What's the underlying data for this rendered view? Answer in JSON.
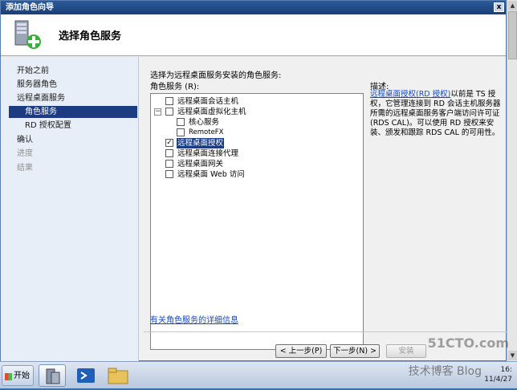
{
  "window": {
    "title": "添加角色向导",
    "close_glyph": "x"
  },
  "header": {
    "title": "选择角色服务"
  },
  "nav": {
    "items": [
      {
        "label": "开始之前",
        "state": "normal"
      },
      {
        "label": "服务器角色",
        "state": "normal"
      },
      {
        "label": "远程桌面服务",
        "state": "normal"
      },
      {
        "label": "角色服务",
        "state": "active"
      },
      {
        "label": "RD 授权配置",
        "state": "sub"
      },
      {
        "label": "确认",
        "state": "normal"
      },
      {
        "label": "进度",
        "state": "disabled"
      },
      {
        "label": "结果",
        "state": "disabled"
      }
    ]
  },
  "content": {
    "prompt": "选择为远程桌面服务安装的角色服务:",
    "role_services_label": "角色服务 (R):",
    "tree": [
      {
        "label": "远程桌面会话主机",
        "checked": false,
        "level": 0
      },
      {
        "label": "远程桌面虚拟化主机",
        "checked": false,
        "level": 0,
        "expander": "−"
      },
      {
        "label": "核心服务",
        "checked": false,
        "level": 1
      },
      {
        "label": "RemoteFX",
        "checked": false,
        "level": 1
      },
      {
        "label": "远程桌面授权",
        "checked": true,
        "level": 0,
        "selected": true
      },
      {
        "label": "远程桌面连接代理",
        "checked": false,
        "level": 0
      },
      {
        "label": "远程桌面网关",
        "checked": false,
        "level": 0
      },
      {
        "label": "远程桌面 Web 访问",
        "checked": false,
        "level": 0
      }
    ],
    "description_title": "描述:",
    "description_link": "远程桌面授权(RD 授权)",
    "description_text": "以前是 TS 授权，它管理连接到 RD 会话主机服务器所需的远程桌面服务客户端访问许可证(RDS CAL)。可以使用 RD 授权来安装、颁发和跟踪 RDS CAL 的可用性。",
    "more_info_link": "有关角色服务的详细信息"
  },
  "buttons": {
    "previous": "< 上一步(P)",
    "next": "下一步(N) >",
    "install": "安装"
  },
  "taskbar": {
    "start_label": "开始",
    "clock_time": "16:",
    "clock_date": "11/4/27"
  },
  "watermark": {
    "site": "51CTO.com",
    "blog": "技术博客 Blog"
  }
}
